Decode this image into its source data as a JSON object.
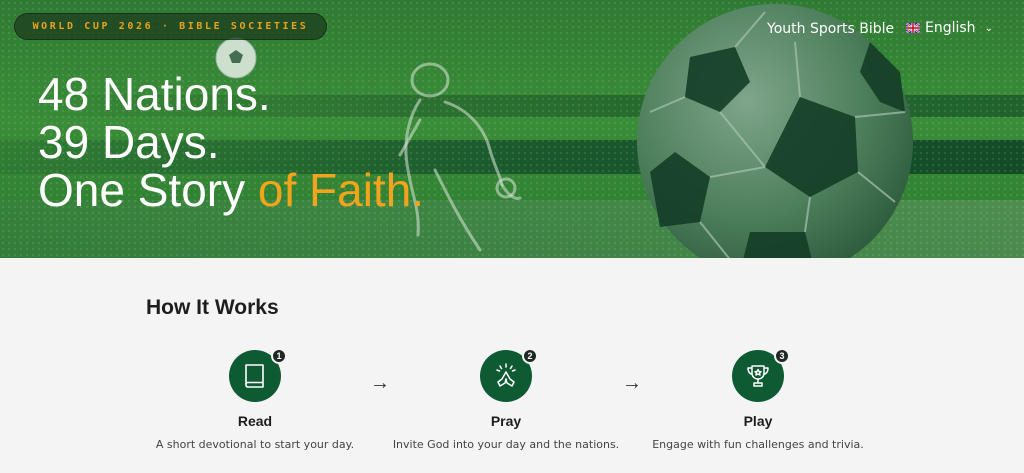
{
  "header": {
    "badge": "WORLD CUP 2026 · BIBLE SOCIETIES",
    "nav_link": "Youth Sports Bible",
    "language": {
      "label": "English",
      "flag_icon": "uk-flag-icon"
    }
  },
  "hero": {
    "line1": "48 Nations.",
    "line2": "39 Days.",
    "line3_plain": "One Story ",
    "line3_accent": "of Faith.",
    "accent_color": "#f4a41c"
  },
  "how_it_works": {
    "title": "How It Works",
    "steps": [
      {
        "number": "1",
        "name": "Read",
        "description": "A short devotional to start your day.",
        "icon": "book-icon"
      },
      {
        "number": "2",
        "name": "Pray",
        "description": "Invite God into your day and the nations.",
        "icon": "praying-hands-icon"
      },
      {
        "number": "3",
        "name": "Play",
        "description": "Engage with fun challenges and trivia.",
        "icon": "trophy-icon"
      }
    ],
    "arrow": "→",
    "brand_color": "#0d5a33"
  }
}
